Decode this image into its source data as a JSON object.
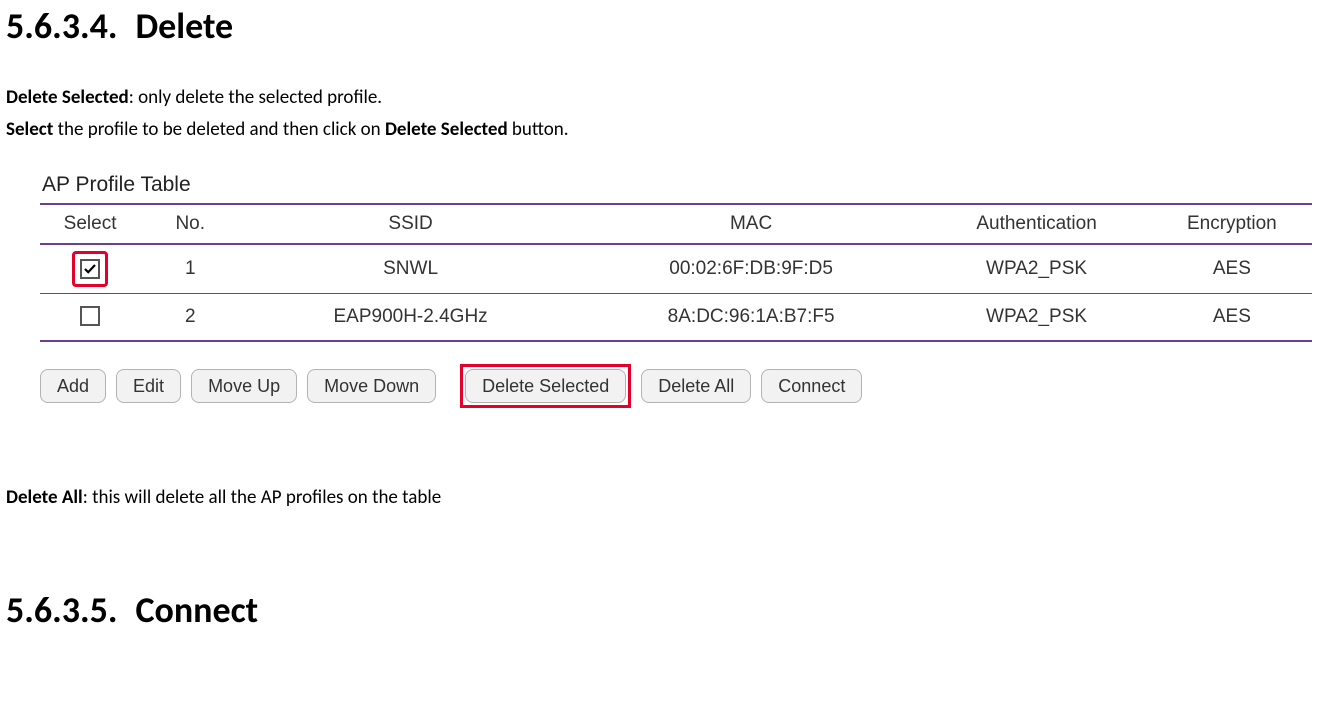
{
  "section_delete": {
    "number": "5.6.3.4.",
    "title": "Delete"
  },
  "intro": {
    "delete_selected_label": "Delete Selected",
    "delete_selected_rest": ": only delete the selected profile.",
    "line2_bold_a": "Select",
    "line2_mid": " the profile to be deleted and then click on ",
    "line2_bold_b": "Delete Selected",
    "line2_rest": " button."
  },
  "ap_table": {
    "title": "AP Profile Table",
    "headers": {
      "select": "Select",
      "no": "No.",
      "ssid": "SSID",
      "mac": "MAC",
      "auth": "Authentication",
      "enc": "Encryption"
    },
    "rows": [
      {
        "selected": true,
        "highlight": true,
        "no": "1",
        "ssid": "SNWL",
        "mac": "00:02:6F:DB:9F:D5",
        "auth": "WPA2_PSK",
        "enc": "AES"
      },
      {
        "selected": false,
        "highlight": false,
        "no": "2",
        "ssid": "EAP900H-2.4GHz",
        "mac": "8A:DC:96:1A:B7:F5",
        "auth": "WPA2_PSK",
        "enc": "AES"
      }
    ]
  },
  "buttons": {
    "add": "Add",
    "edit": "Edit",
    "move_up": "Move Up",
    "move_down": "Move Down",
    "delete_selected": "Delete Selected",
    "delete_all": "Delete All",
    "connect": "Connect"
  },
  "delete_all_note": {
    "label": "Delete All",
    "rest": ": this will delete all the AP profiles on the table"
  },
  "section_connect": {
    "number": "5.6.3.5.",
    "title": "Connect"
  }
}
